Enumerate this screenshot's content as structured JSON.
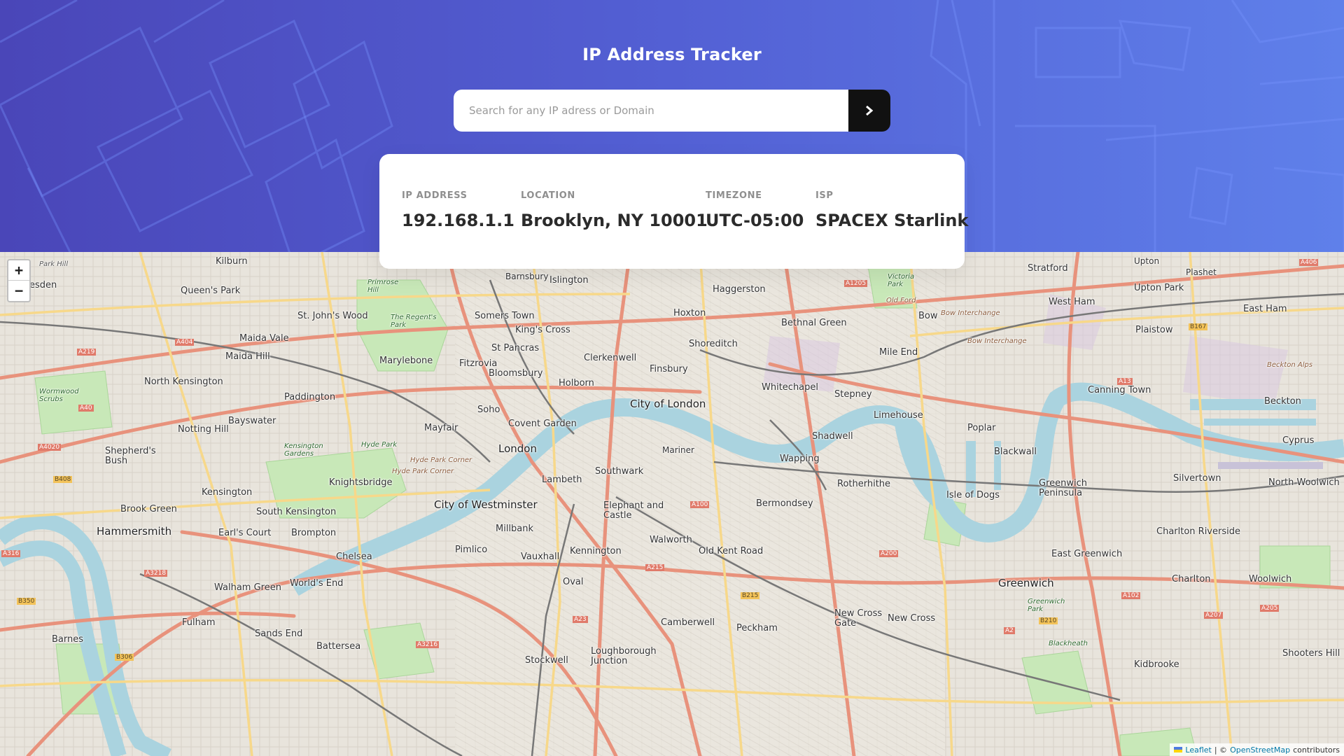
{
  "header": {
    "title": "IP Address Tracker"
  },
  "search": {
    "placeholder": "Search for any IP adress or Domain",
    "value": "",
    "submit_icon": "chevron-right-icon"
  },
  "info": {
    "items": [
      {
        "label": "IP ADDRESS",
        "value": "192.168.1.1"
      },
      {
        "label": "LOCATION",
        "value": "Brooklyn, NY 10001"
      },
      {
        "label": "TIMEZONE",
        "value": "UTC-05:00"
      },
      {
        "label": "ISP",
        "value": "SPACEX Starlink"
      }
    ]
  },
  "map": {
    "zoom_in": "+",
    "zoom_out": "−",
    "attribution": {
      "leaflet": "Leaflet",
      "separator": "| ©",
      "osm": "OpenStreetMap",
      "suffix": "contributors"
    },
    "labels": {
      "kilburn": "Kilburn",
      "islington": "Islington",
      "haggerston": "Haggerston",
      "stratford": "Stratford",
      "upton": "Upton",
      "plashet": "Plashet",
      "queens_park": "Queen's Park",
      "st_johns_wood": "St. John's Wood",
      "somers_town": "Somers Town",
      "hoxton": "Hoxton",
      "bethnal_green": "Bethnal Green",
      "west_ham": "West Ham",
      "upton_park": "Upton Park",
      "east_ham": "East Ham",
      "maida_vale": "Maida Vale",
      "kings_cross": "King's Cross",
      "shoreditch": "Shoreditch",
      "bow": "Bow",
      "plaistow": "Plaistow",
      "maida_hill": "Maida Hill",
      "marylebone": "Marylebone",
      "st_pancras": "St Pancras",
      "clerkenwell": "Clerkenwell",
      "mile_end": "Mile End",
      "north_kensington": "North Kensington",
      "fitzrovia": "Fitzrovia",
      "bloomsbury": "Bloomsbury",
      "finsbury": "Finsbury",
      "holborn": "Holborn",
      "whitechapel": "Whitechapel",
      "stepney": "Stepney",
      "canning_town": "Canning Town",
      "paddington": "Paddington",
      "city_of_london": "City of London",
      "beckton": "Beckton",
      "bayswater": "Bayswater",
      "soho": "Soho",
      "limehouse": "Limehouse",
      "notting_hill": "Notting Hill",
      "mayfair": "Mayfair",
      "covent_garden": "Covent Garden",
      "poplar": "Poplar",
      "shadwell": "Shadwell",
      "cyprus": "Cyprus",
      "shepherds_bush": "Shepherd's\nBush",
      "london": "London",
      "blackwall": "Blackwall",
      "wapping": "Wapping",
      "southwark": "Southwark",
      "silvertown": "Silvertown",
      "north_woolwich": "North Woolwich",
      "lambeth": "Lambeth",
      "kensington": "Kensington",
      "knightsbridge": "Knightsbridge",
      "rotherhithe": "Rotherhithe",
      "greenwich_peninsula": "Greenwich\nPeninsula",
      "isle_of_dogs": "Isle of Dogs",
      "city_of_westminster": "City of Westminster",
      "bermondsey": "Bermondsey",
      "brook_green": "Brook Green",
      "south_kensington": "South Kensington",
      "elephant_and_castle": "Elephant and\nCastle",
      "hammersmith": "Hammersmith",
      "earls_court": "Earl's Court",
      "brompton": "Brompton",
      "millbank": "Millbank",
      "charlton_riverside": "Charlton Riverside",
      "walworth": "Walworth",
      "pimlico": "Pimlico",
      "old_kent_road": "Old Kent Road",
      "kennington": "Kennington",
      "chelsea": "Chelsea",
      "vauxhall": "Vauxhall",
      "east_greenwich": "East Greenwich",
      "charlton": "Charlton",
      "woolwich": "Woolwich",
      "oval": "Oval",
      "greenwich": "Greenwich",
      "walham_green": "Walham Green",
      "worlds_end": "World's End",
      "fulham": "Fulham",
      "new_cross_gate": "New Cross\nGate",
      "new_cross": "New Cross",
      "camberwell": "Camberwell",
      "peckham": "Peckham",
      "sands_end": "Sands End",
      "barnes": "Barnes",
      "battersea": "Battersea",
      "stockwell": "Stockwell",
      "loughborough_junction": "Loughborough\nJunction",
      "kidbrooke": "Kidbrooke",
      "shooters_hill": "Shooters Hill",
      "park_hill": "Park Hill",
      "nesden": "esden",
      "primrose_hill": "Primrose\nHill",
      "barnsbury": "Barnsbury",
      "regents_park": "The Regent's\nPark",
      "victoria_park": "Victoria\nPark",
      "old_ford": "Old Ford",
      "hyde_park": "Hyde Park",
      "kensington_gardens": "Kensington\nGardens",
      "hyde_park_corner": "Hyde Park Corner",
      "wormwood_scrubs": "Wormwood\nScrubs",
      "mariner": "Mariner",
      "bow_interchange": "Bow Interchange",
      "greenwich_park": "Greenwich\nPark",
      "blackheath": "Blackheath",
      "beckton_alps": "Beckton Alps",
      "a406": "A406",
      "a1205": "A1205",
      "a404": "A404",
      "a219": "A219",
      "a40": "A40",
      "a4020": "A4020",
      "b408": "B408",
      "a316": "A316",
      "a3218": "A3218",
      "b350": "B350",
      "b306": "B306",
      "a3216": "A3216",
      "a215": "A215",
      "a100": "A100",
      "b215": "B215",
      "a23": "A23",
      "a200": "A200",
      "a2": "A2",
      "b210": "B210",
      "a102": "A102",
      "a207": "A207",
      "a205": "A205",
      "a13": "A13",
      "b167": "B167"
    }
  }
}
